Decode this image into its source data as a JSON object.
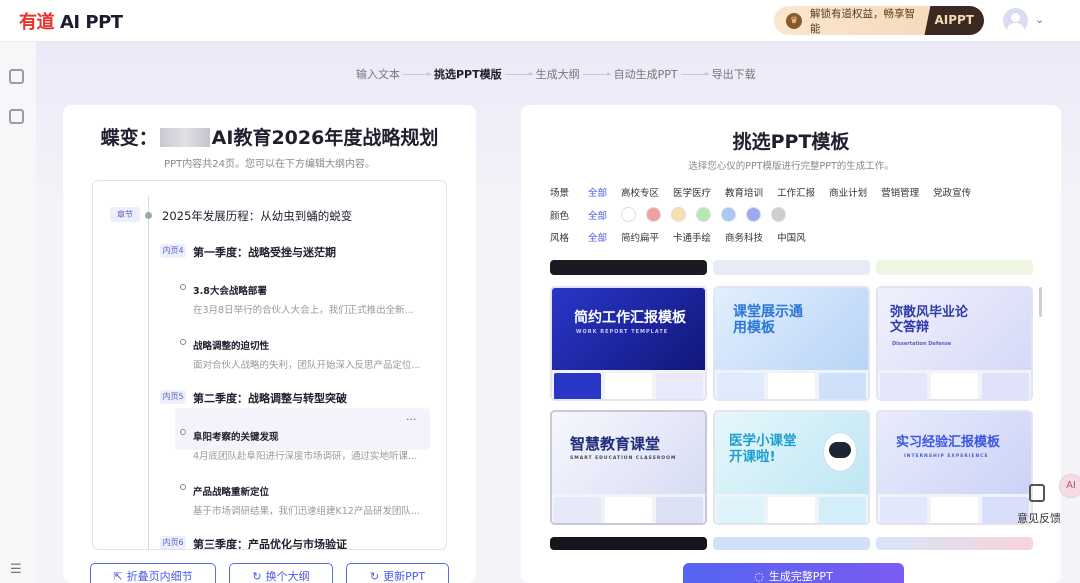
{
  "header": {
    "logo_youdao": "有道",
    "logo_aippt": "AI PPT",
    "promo_text": "解锁有道权益，畅享智能",
    "promo_tag": "AIPPT"
  },
  "steps": [
    {
      "label": "输入文本"
    },
    {
      "label": "挑选PPT模版",
      "active": true
    },
    {
      "label": "生成大纲"
    },
    {
      "label": "自动生成PPT"
    },
    {
      "label": "导出下载"
    }
  ],
  "outline_panel": {
    "title_prefix": "蝶变：",
    "title_suffix": "AI教育2026年度战略规划",
    "subtitle": "PPT内容共24页。您可以在下方编辑大纲内容。",
    "chapter_tag": "章节",
    "chapter_title": "2025年发展历程：从幼虫到蛹的蜕变",
    "pages": [
      {
        "tag": "内页4",
        "title": "第一季度：战略受挫与迷茫期"
      },
      {
        "tag": "内页5",
        "title": "第二季度：战略调整与转型突破"
      },
      {
        "tag": "内页6",
        "title": "第三季度：产品优化与市场验证"
      }
    ],
    "items": [
      {
        "title": "3.8大会战略部署",
        "desc": "在3月8日举行的合伙人大会上，我们正式推出全新..."
      },
      {
        "title": "战略调整的迫切性",
        "desc": "面对合伙人战略的失利，团队开始深入反思产品定位..."
      },
      {
        "title": "阜阳考察的关键发现",
        "desc": "4月底团队赴阜阳进行深度市场调研，通过实地听课..."
      },
      {
        "title": "产品战略重新定位",
        "desc": "基于市场调研结果，我们迅速组建K12产品研发团队..."
      }
    ],
    "more": "···",
    "buttons": {
      "fold": "折叠页内细节",
      "change": "换个大纲",
      "update": "更新PPT"
    }
  },
  "template_panel": {
    "title": "挑选PPT模板",
    "subtitle": "选择您心仪的PPT模版进行完整PPT的生成工作。",
    "filters": {
      "scene_label": "场景",
      "scene_options": [
        "全部",
        "高校专区",
        "医学医疗",
        "教育培训",
        "工作汇报",
        "商业计划",
        "营销管理",
        "党政宣传"
      ],
      "color_label": "颜色",
      "color_all": "全部",
      "colors": [
        "#ffffff",
        "#f0a0a0",
        "#f7dfae",
        "#b8e6b4",
        "#a9c8f5",
        "#9eaaf0",
        "#cfcfcf"
      ],
      "style_label": "风格",
      "style_options": [
        "全部",
        "简约扁平",
        "卡通手绘",
        "商务科技",
        "中国风"
      ]
    },
    "templates": [
      {
        "title": "简约工作汇报模板",
        "sub": "WORK REPORT TEMPLATE",
        "theme": "#1f2aa8",
        "fg": "#ffffff"
      },
      {
        "title": "课堂展示通用模板",
        "sub": "",
        "theme": "#cfe4fb",
        "fg": "#2c78d6"
      },
      {
        "title": "弥散风毕业论文答辩",
        "sub": "Dissertation Defense",
        "theme": "#e8e9fb",
        "fg": "#2e3aa8"
      },
      {
        "title": "智慧教育课堂",
        "sub": "SMART EDUCATION CLASSROOM",
        "theme": "#eef0fb",
        "fg": "#1f2d7a"
      },
      {
        "title": "医学小课堂开课啦!",
        "sub": "",
        "theme": "#d6f1f8",
        "fg": "#1e9fd0"
      },
      {
        "title": "实习经验汇报模板",
        "sub": "INTERNSHIP EXPERIENCE",
        "theme": "#dfe4fa",
        "fg": "#3a56e0"
      }
    ],
    "generate_button": "生成完整PPT"
  },
  "feedback": {
    "label": "意见反馈",
    "avatar_text": "AI"
  }
}
